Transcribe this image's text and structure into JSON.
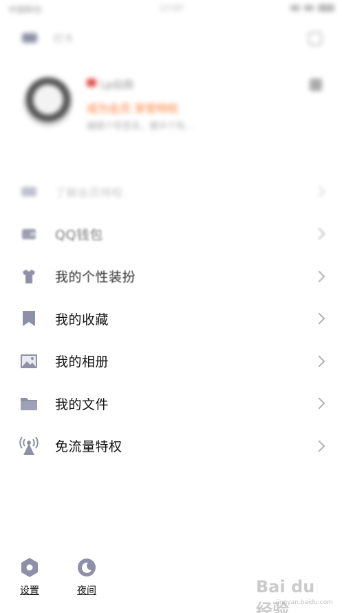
{
  "status_bar": {
    "left_text": "中国移动",
    "time": "17:07"
  },
  "top_bar": {
    "label": "打卡"
  },
  "profile": {
    "nickname": "Lp白鸽",
    "vip_text": "成为会员 享受特权",
    "signature": "编辑个性签名，展示个性..."
  },
  "menu": {
    "items": [
      {
        "label": "了解会员特权",
        "icon": "vip-icon"
      },
      {
        "label": "QQ钱包",
        "icon": "wallet-icon"
      },
      {
        "label": "我的个性装扮",
        "icon": "dress-up-icon"
      },
      {
        "label": "我的收藏",
        "icon": "bookmark-icon"
      },
      {
        "label": "我的相册",
        "icon": "photo-album-icon"
      },
      {
        "label": "我的文件",
        "icon": "folder-icon"
      },
      {
        "label": "免流量特权",
        "icon": "signal-tower-icon"
      }
    ]
  },
  "bottom_bar": {
    "settings_label": "设置",
    "night_label": "夜间"
  },
  "watermark": {
    "main": "Bai du 经验",
    "sub": "jingyan.baidu.com"
  },
  "colors": {
    "icon_gray": "#8d90a6",
    "vip_orange": "#ff7a32",
    "heart_red": "#e2534d",
    "chevron": "#b0b0b0"
  }
}
